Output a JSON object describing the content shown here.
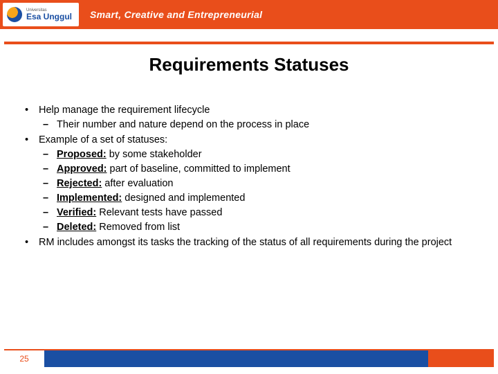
{
  "header": {
    "university_small": "Universitas",
    "university": "Esa Unggul",
    "tagline": "Smart, Creative and Entrepreneurial"
  },
  "slide": {
    "title": "Requirements Statuses",
    "page_number": "25"
  },
  "content": {
    "b1": "Help manage the requirement lifecycle",
    "b1s1": "Their number and nature depend on the process in place",
    "b2": "Example of a set of statuses:",
    "statuses": {
      "proposed": {
        "term": "Proposed:",
        "desc": " by some stakeholder"
      },
      "approved": {
        "term": "Approved:",
        "desc": " part of baseline, committed to implement"
      },
      "rejected": {
        "term": "Rejected:",
        "desc": " after evaluation"
      },
      "implemented": {
        "term": "Implemented:",
        "desc": " designed and implemented"
      },
      "verified": {
        "term": "Verified:",
        "desc": " Relevant tests have passed"
      },
      "deleted": {
        "term": "Deleted:",
        "desc": " Removed from list"
      }
    },
    "b3": "RM includes amongst its tasks the tracking of the status of all requirements during the project"
  }
}
